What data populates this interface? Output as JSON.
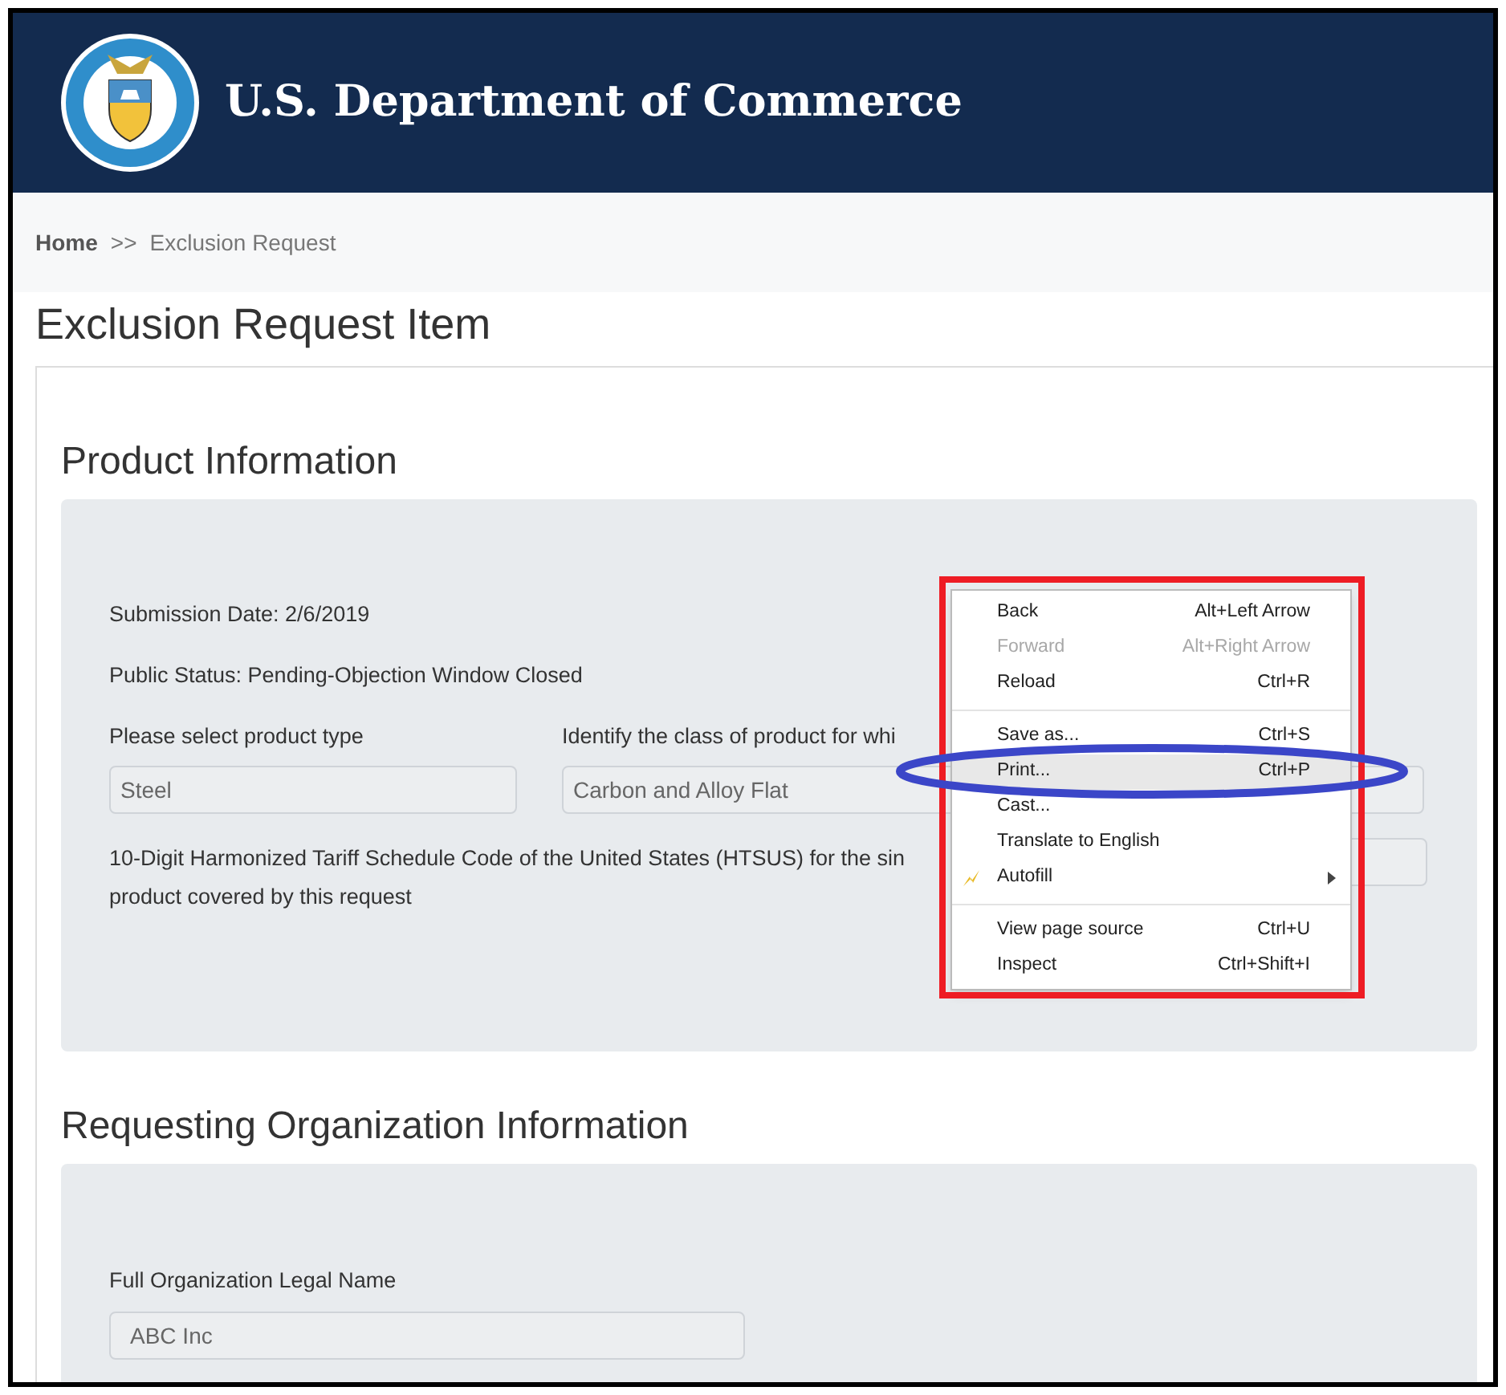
{
  "header": {
    "title": "U.S. Department of Commerce"
  },
  "breadcrumb": {
    "items": [
      {
        "label": "Home",
        "selected": false
      },
      {
        "label": "Exclusion Request",
        "selected": true
      }
    ],
    "separator": ">>"
  },
  "page_title": "Exclusion Request Item",
  "product_section": {
    "heading": "Product Information",
    "submission_date": "Submission Date: 2/6/2019",
    "public_status": "Public Status: Pending-Objection Window Closed",
    "product_type": {
      "label": "Please select product type",
      "value": "Steel"
    },
    "product_class": {
      "label": "Identify the class of product for whi",
      "value": "Carbon and Alloy Flat"
    },
    "htsus": {
      "label_lines": [
        "10-Digit Harmonized Tariff Schedule Code of the United States (HTSUS) for the sin",
        "product covered by this request"
      ]
    }
  },
  "organization_section": {
    "heading": "Requesting Organization Information",
    "legal_name": {
      "label": "Full Organization Legal Name",
      "value": "ABC Inc"
    }
  },
  "context_menu": {
    "groups": [
      [
        {
          "kind": "plain",
          "label": "Back",
          "shortcut": "Alt+Left Arrow",
          "disabled": false,
          "selected": false
        },
        {
          "kind": "plain",
          "label": "Forward",
          "shortcut": "Alt+Right Arrow",
          "disabled": true,
          "selected": false
        },
        {
          "kind": "plain",
          "label": "Reload",
          "shortcut": "Ctrl+R",
          "disabled": false,
          "selected": false
        }
      ],
      [
        {
          "kind": "plain",
          "label": "Save as...",
          "shortcut": "Ctrl+S",
          "disabled": false,
          "selected": false
        },
        {
          "kind": "plain",
          "label": "Print...",
          "shortcut": "Ctrl+P",
          "disabled": false,
          "selected": true
        },
        {
          "kind": "plain",
          "label": "Cast...",
          "disabled": false,
          "selected": false
        },
        {
          "kind": "plain",
          "label": "Translate to English",
          "disabled": false,
          "selected": false
        },
        {
          "kind": "submenu",
          "label": "Autofill",
          "disabled": false,
          "selected": false
        }
      ],
      [
        {
          "kind": "plain",
          "label": "View page source",
          "shortcut": "Ctrl+U",
          "disabled": false,
          "selected": false
        },
        {
          "kind": "plain",
          "label": "Inspect",
          "shortcut": "Ctrl+Shift+I",
          "disabled": false,
          "selected": false
        }
      ]
    ]
  }
}
